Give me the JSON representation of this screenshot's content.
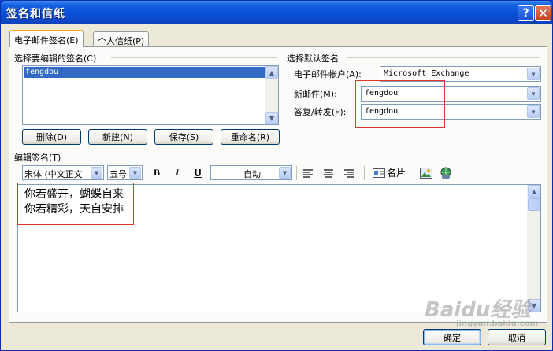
{
  "window": {
    "title": "签名和信纸",
    "help_label": "?",
    "close_label": "✕"
  },
  "tabs": [
    {
      "label": "电子邮件签名(E)",
      "active": true
    },
    {
      "label": "个人信纸(P)",
      "active": false
    }
  ],
  "select_group": {
    "label": "选择要编辑的签名(C)",
    "items": [
      "fengdou"
    ],
    "selected": "fengdou"
  },
  "signature_buttons": {
    "delete": "删除(D)",
    "new": "新建(N)",
    "save": "保存(S)",
    "rename": "重命名(R)"
  },
  "default_group": {
    "label": "选择默认签名",
    "account_label": "电子邮件帐户(A):",
    "account_value": "Microsoft Exchange",
    "new_label": "新邮件(M):",
    "new_value": "fengdou",
    "reply_label": "答复/转发(F):",
    "reply_value": "fengdou"
  },
  "edit_group": {
    "label": "编辑签名(T)"
  },
  "toolbar": {
    "font": "宋体 (中文正文",
    "size": "五号",
    "bold": "B",
    "italic": "I",
    "underline": "U",
    "color": "自动",
    "business_card": "名片"
  },
  "editor": {
    "lines": [
      "你若盛开，蝴蝶自来",
      "你若精彩，天自安排"
    ]
  },
  "footer": {
    "ok": "确定",
    "cancel": "取消"
  },
  "watermark": {
    "main": "Baidu经验",
    "sub": "jingyan.baidu.com"
  },
  "colors": {
    "titlebar": "#0a4fd8",
    "selection": "#316ac5",
    "highlight_box": "#e0342d",
    "tab_accent": "#f7a51c"
  },
  "icons": [
    "align-left-icon",
    "align-center-icon",
    "align-right-icon",
    "business-card-icon",
    "insert-picture-icon",
    "hyperlink-icon"
  ]
}
